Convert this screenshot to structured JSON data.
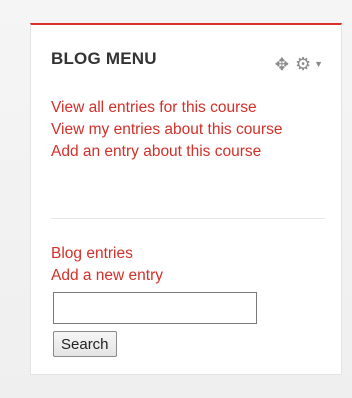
{
  "block": {
    "title": "BLOG MENU",
    "accent_color": "#d9302c",
    "icons": {
      "move": "move-icon",
      "settings": "gear-icon",
      "menu_caret": "caret-down-icon"
    }
  },
  "course_links": [
    {
      "label": "View all entries for this course"
    },
    {
      "label": "View my entries about this course"
    },
    {
      "label": "Add an entry about this course"
    }
  ],
  "blog_links": [
    {
      "label": "Blog entries"
    },
    {
      "label": "Add a new entry"
    }
  ],
  "search": {
    "value": "",
    "button_label": "Search"
  }
}
